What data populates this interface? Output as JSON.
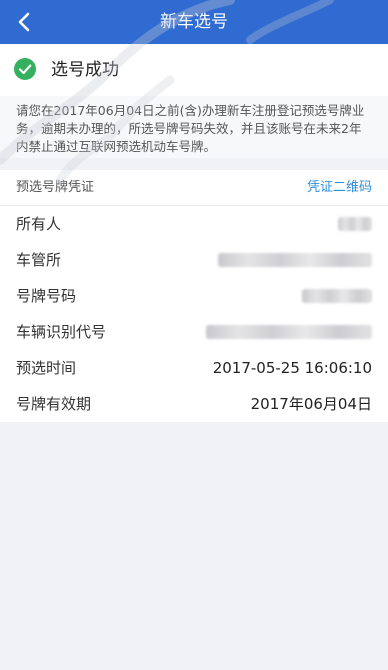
{
  "nav": {
    "title": "新车选号"
  },
  "status": {
    "text": "选号成功"
  },
  "notice": {
    "text": "请您在2017年06月04日之前(含)办理新车注册登记预选号牌业务，逾期未办理的，所选号牌号码失效，并且该账号在未来2年内禁止通过互联网预选机动车号牌。"
  },
  "voucher": {
    "title": "预选号牌凭证",
    "qr_link": "凭证二维码",
    "rows": [
      {
        "label": "所有人",
        "value": ""
      },
      {
        "label": "车管所",
        "value": ""
      },
      {
        "label": "号牌号码",
        "value": ""
      },
      {
        "label": "车辆识别代号",
        "value": ""
      },
      {
        "label": "预选时间",
        "value": "2017-05-25 16:06:10"
      },
      {
        "label": "号牌有效期",
        "value": "2017年06月04日"
      }
    ]
  },
  "colors": {
    "navbar": "#2f6bd0",
    "success": "#35b05f",
    "link": "#2f8fdc"
  }
}
